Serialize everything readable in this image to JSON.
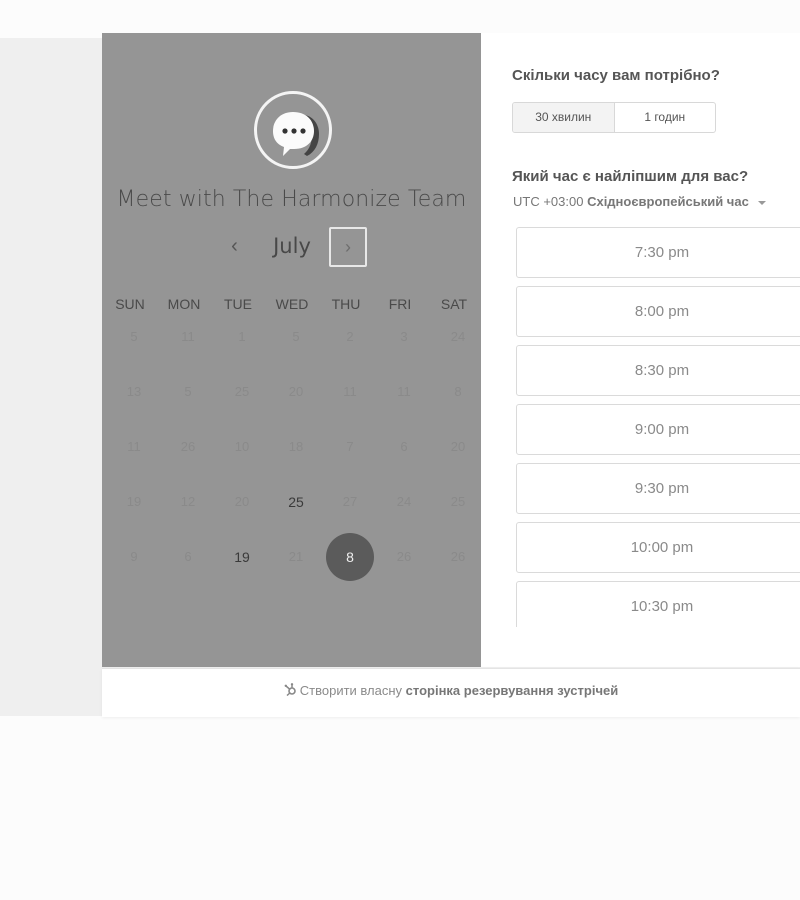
{
  "meeting": {
    "title": "Meet with The Harmonize Team",
    "logo_icon": "chat-bubble-icon"
  },
  "calendar": {
    "month": "July",
    "prev_icon": "chevron-left-icon",
    "next_icon": "chevron-right-icon",
    "weekdays": [
      "SUN",
      "MON",
      "TUE",
      "WED",
      "THU",
      "FRI",
      "SAT"
    ],
    "weeks": [
      [
        "5",
        "11",
        "1",
        "5",
        "2",
        "3",
        "24"
      ],
      [
        "13",
        "5",
        "25",
        "20",
        "11",
        "11",
        "8"
      ],
      [
        "11",
        "26",
        "10",
        "18",
        "7",
        "6",
        "20"
      ],
      [
        "19",
        "12",
        "20",
        "25",
        "27",
        "24",
        "25"
      ],
      [
        "9",
        "6",
        "19",
        "21",
        "8",
        "26",
        "26"
      ]
    ],
    "available_cells": [
      [
        3,
        3
      ],
      [
        4,
        2
      ]
    ],
    "selected_cell": [
      4,
      4
    ]
  },
  "duration": {
    "heading": "Скільки часу вам потрібно?",
    "options": [
      "30 хвилин",
      "1 годин"
    ],
    "selected": "30 хвилин"
  },
  "time": {
    "heading": "Який час є найліпшим для вас?",
    "timezone_offset": "UTC +03:00",
    "timezone_name": "Східноєвропейський час",
    "slots": [
      "7:30 pm",
      "8:00 pm",
      "8:30 pm",
      "9:00 pm",
      "9:30 pm",
      "10:00 pm",
      "10:30 pm"
    ]
  },
  "footer": {
    "prefix": "Створити власну",
    "link": "сторінка резервування зустрічей",
    "icon": "sprocket-icon"
  },
  "colors": {
    "left_panel": "#959595",
    "selected_day": "#5b5b5b",
    "page_band": "#efefef"
  }
}
